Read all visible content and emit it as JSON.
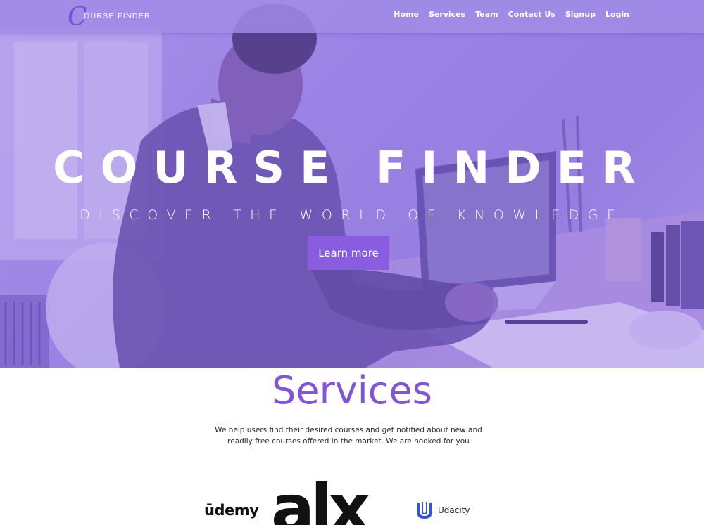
{
  "nav": {
    "logo_initial": "C",
    "logo_text": "OURSE FINDER",
    "links": [
      "Home",
      "Services",
      "Team",
      "Contact Us",
      "Signup",
      "Login"
    ]
  },
  "hero": {
    "title": "COURSE FINDER",
    "subtitle": "DISCOVER THE WORLD OF KNOWLEDGE",
    "cta_label": "Learn more"
  },
  "services": {
    "title": "Services",
    "description": "We help users find their desired courses and get notified about new and readily free courses offered in the market. We are hooked for you"
  },
  "partners": {
    "udemy": "ūdemy",
    "alx": "alx",
    "udacity": "Udacity"
  },
  "colors": {
    "accent": "#8155d6",
    "button": "#8a5ce0",
    "nav_bg": "#a08ce6"
  }
}
